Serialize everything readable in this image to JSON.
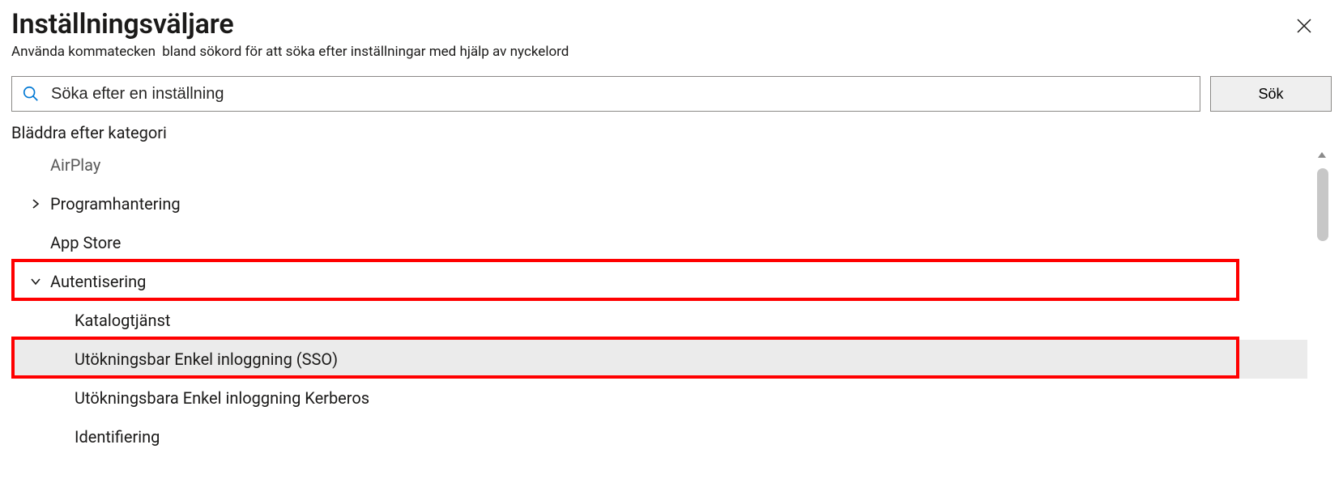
{
  "header": {
    "title": "Inställningsväljare",
    "subtitle_part1": "Använda kommatecken",
    "subtitle_part2": "bland sökord för att söka efter inställningar med hjälp av nyckelord"
  },
  "search": {
    "placeholder": "Söka efter en inställning",
    "button_label": "Sök"
  },
  "browse_label": "Bläddra efter kategori",
  "categories": {
    "airplay": "AirPlay",
    "programhantering": "Programhantering",
    "app_store": "App Store",
    "autentisering": "Autentisering",
    "katalogtjanst": "Katalogtjänst",
    "sso": "Utökningsbar Enkel inloggning (SSO)",
    "sso_kerberos": "Utökningsbara Enkel inloggning   Kerberos",
    "identifiering": "Identifiering"
  },
  "colors": {
    "highlight": "#ff0000",
    "icon_blue": "#0078d4"
  }
}
